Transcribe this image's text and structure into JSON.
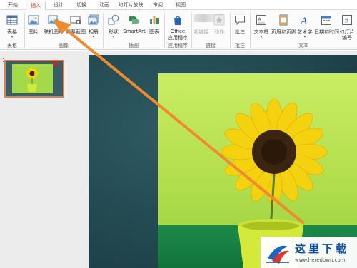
{
  "tabs": [
    "开始",
    "插入",
    "设计",
    "切换",
    "动画",
    "幻灯片放映",
    "审阅",
    "视图"
  ],
  "active_tab": "插入",
  "ribbon": {
    "table": {
      "label": "表格",
      "group": "表格"
    },
    "picture": "图片",
    "online_picture": "联机图片",
    "screenshot": "屏幕截图",
    "album": "相册",
    "images_group": "图像",
    "shapes": "形状",
    "smartart": "SmartArt",
    "chart": "图表",
    "illustrations_group": "插图",
    "office_apps_line1": "Office",
    "office_apps_line2": "应用程序",
    "apps_group": "应用程序",
    "hyperlink": "超链接",
    "action": "动作",
    "links_group": "链接",
    "comment": "批注",
    "comments_group": "批注",
    "textbox": "文本框",
    "header_footer": "页眉和页脚",
    "wordart": "艺术字",
    "datetime": "日期和时间",
    "slide_number_line1": "幻灯片",
    "slide_number_line2": "编号",
    "text_group": "文本"
  },
  "slides_panel": {
    "slide_number": "1"
  },
  "watermark": {
    "brand": "这里下载",
    "url": "www.heredown.com"
  },
  "colors": {
    "accent": "#c43e1c",
    "arrow": "#f08a2e",
    "slide_bg": "#244b53",
    "photo_green": "#b5e04e",
    "flower_yellow": "#f5d20f"
  }
}
